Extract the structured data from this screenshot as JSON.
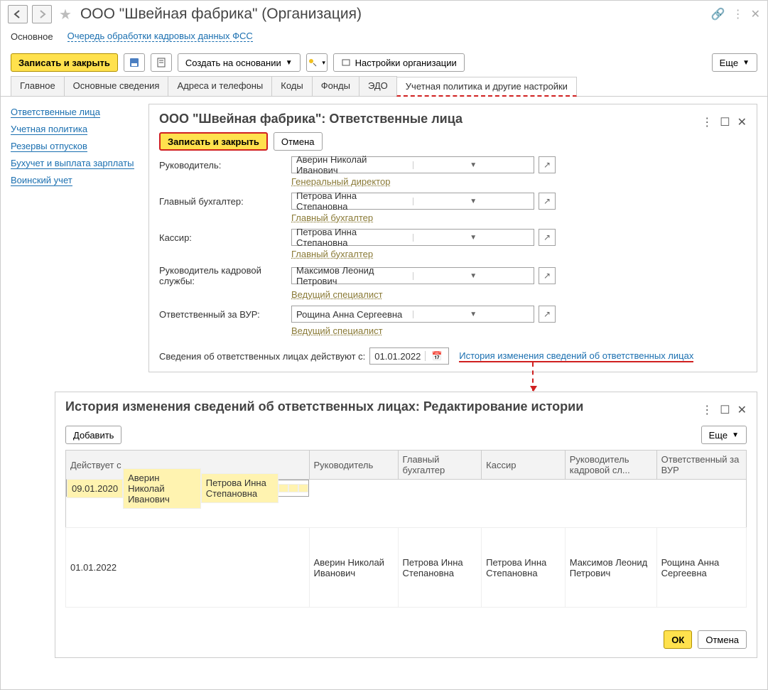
{
  "header": {
    "title": "ООО \"Швейная фабрика\" (Организация)"
  },
  "subhead": {
    "active": "Основное",
    "link": "Очередь обработки кадровых данных ФСС"
  },
  "toolbar": {
    "save_close": "Записать и закрыть",
    "create_based": "Создать на основании",
    "org_settings": "Настройки организации",
    "more": "Еще"
  },
  "tabs": [
    "Главное",
    "Основные сведения",
    "Адреса и телефоны",
    "Коды",
    "Фонды",
    "ЭДО",
    "Учетная политика и другие настройки"
  ],
  "leftnav": [
    "Ответственные лица",
    "Учетная политика",
    "Резервы отпусков",
    "Бухучет и выплата зарплаты",
    "Воинский учет"
  ],
  "panel1": {
    "title": "ООО \"Швейная фабрика\": Ответственные лица",
    "save_close": "Записать и закрыть",
    "cancel": "Отмена",
    "rows": [
      {
        "label": "Руководитель:",
        "value": "Аверин Николай Иванович",
        "sub": "Генеральный директор"
      },
      {
        "label": "Главный бухгалтер:",
        "value": "Петрова Инна Степановна",
        "sub": "Главный бухгалтер"
      },
      {
        "label": "Кассир:",
        "value": "Петрова Инна Степановна",
        "sub": "Главный бухгалтер"
      },
      {
        "label": "Руководитель кадровой службы:",
        "value": "Максимов Леонид Петрович",
        "sub": "Ведущий специалист"
      },
      {
        "label": "Ответственный за ВУР:",
        "value": "Рощина Анна Сергеевна",
        "sub": "Ведущий специалист"
      }
    ],
    "date_label": "Сведения об ответственных лицах действуют с:",
    "date_value": "01.01.2022",
    "history_link": "История изменения сведений об ответственных лицах"
  },
  "panel2": {
    "title": "История изменения сведений об ответственных лицах: Редактирование истории",
    "add": "Добавить",
    "more": "Еще",
    "ok": "ОК",
    "cancel": "Отмена",
    "cols": [
      "Действует с",
      "Руководитель",
      "Главный бухгалтер",
      "Кассир",
      "Руководитель кадровой сл...",
      "Ответственный за ВУР"
    ],
    "rows": [
      {
        "d": "09.01.2020",
        "c1": "Аверин Николай Иванович",
        "c2": "Петрова Инна Степановна",
        "c3": "",
        "c4": "",
        "c5": ""
      },
      {
        "d": "01.01.2022",
        "c1": "Аверин Николай Иванович",
        "c2": "Петрова Инна Степановна",
        "c3": "Петрова Инна Степановна",
        "c4": "Максимов Леонид Петрович",
        "c5": "Рощина Анна Сергеевна"
      }
    ]
  }
}
